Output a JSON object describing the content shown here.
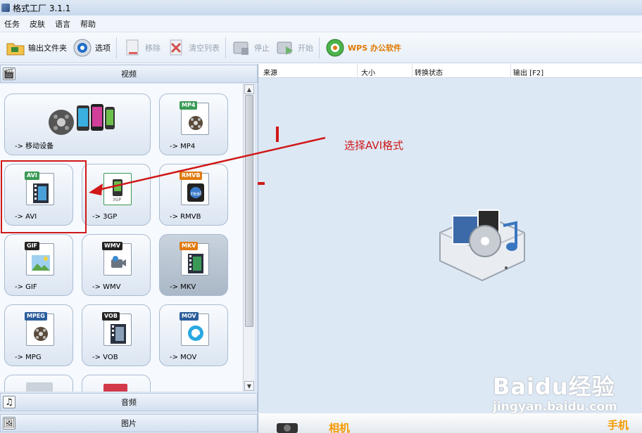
{
  "window": {
    "title": "格式工厂 3.1.1"
  },
  "menu": [
    "任务",
    "皮肤",
    "语言",
    "帮助"
  ],
  "toolbar": {
    "output_folder": "输出文件夹",
    "options": "选项",
    "remove": "移除",
    "clear_list": "清空列表",
    "stop": "停止",
    "start": "开始",
    "wps": "WPS 办公软件"
  },
  "categories": {
    "video": "视频",
    "audio": "音频",
    "image": "图片"
  },
  "formats": [
    {
      "label": "-> 移动设备",
      "badge": ""
    },
    {
      "label": "-> MP4",
      "badge": "MP4",
      "color": "#3a9a55"
    },
    {
      "label": "-> AVI",
      "badge": "AVI",
      "color": "#3a9a55"
    },
    {
      "label": "-> 3GP",
      "badge": "3GP",
      "color": "#3a9a55"
    },
    {
      "label": "-> RMVB",
      "badge": "RMVB",
      "color": "#e07a10"
    },
    {
      "label": "-> GIF",
      "badge": "GIF",
      "color": "#222222"
    },
    {
      "label": "-> WMV",
      "badge": "WMV",
      "color": "#222222"
    },
    {
      "label": "-> MKV",
      "badge": "MKV",
      "color": "#e07a10"
    },
    {
      "label": "-> MPG",
      "badge": "MPEG",
      "color": "#2a5c9a"
    },
    {
      "label": "-> VOB",
      "badge": "VOB",
      "color": "#222222"
    },
    {
      "label": "-> MOV",
      "badge": "MOV",
      "color": "#2a5c9a"
    }
  ],
  "columns": {
    "source": "来源",
    "size": "大小",
    "status": "转换状态",
    "output": "输出 [F2]"
  },
  "annotation": "选择AVI格式",
  "bottom_strip": {
    "left": "相机",
    "right": "手机"
  },
  "watermark": {
    "logo": "Baidu经验",
    "url": "jingyan.baidu.com"
  },
  "colors": {
    "annotation": "#d01818",
    "accent": "#e07800"
  }
}
